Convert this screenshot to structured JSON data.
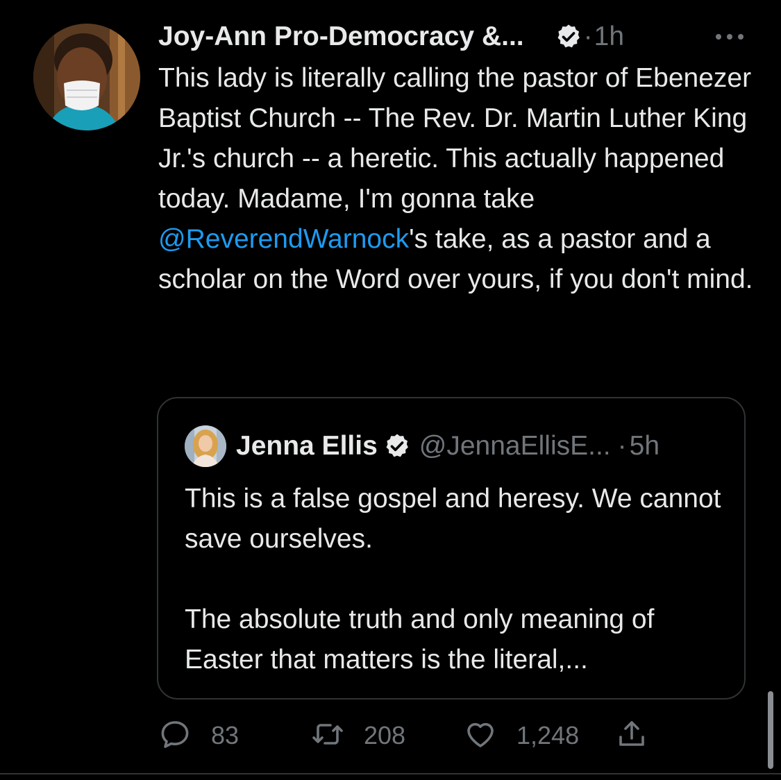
{
  "tweet": {
    "author_name": "Joy-Ann Pro-Democracy &...",
    "dot": "·",
    "time": "1h",
    "text_before": "This lady is literally calling the pastor of Ebenezer Baptist Church -- The Rev. Dr. Martin Luther King Jr.'s church -- a heretic. This actually happened today. Madame, I'm gonna take ",
    "mention": "@ReverendWarnock",
    "text_after": "'s take, as a pastor and a scholar on the Word over yours, if you don't mind."
  },
  "quote": {
    "name": "Jenna Ellis",
    "handle": "@JennaEllisE...",
    "dot": "·",
    "time": "5h",
    "text": "This is a false gospel and heresy. We cannot save ourselves.\n\nThe absolute truth and only meaning of Easter that matters is the literal,..."
  },
  "actions": {
    "replies": "83",
    "retweets": "208",
    "likes": "1,248"
  },
  "icons": {
    "verified": "verified-badge-icon",
    "more": "more-icon",
    "reply": "reply-icon",
    "retweet": "retweet-icon",
    "like": "heart-icon",
    "share": "share-icon"
  },
  "colors": {
    "background": "#000000",
    "text": "#e7e9ea",
    "secondary": "#71767b",
    "link": "#1d9bf0",
    "border": "#2f3336"
  }
}
